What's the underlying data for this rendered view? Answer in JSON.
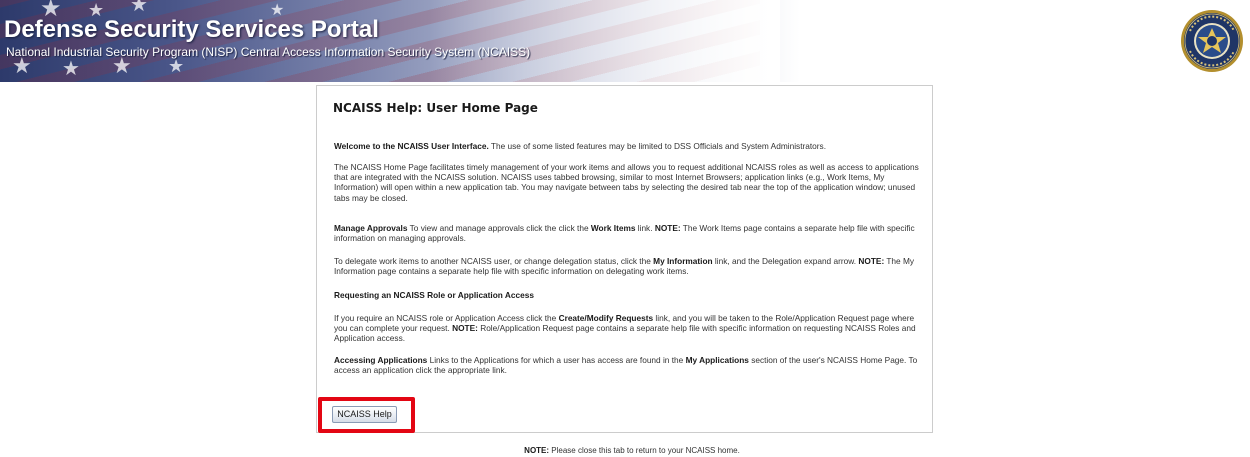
{
  "banner": {
    "title": "Defense Security Services Portal",
    "subtitle": "National Industrial Security Program (NISP) Central Access Information Security System (NCAISS)",
    "seal_icon": "dss-seal-icon"
  },
  "help": {
    "title": "NCAISS Help: User Home Page",
    "welcome": {
      "bold": "Welcome to the NCAISS User Interface.",
      "text": " The use of some listed features may be limited to DSS Officials and System Administrators."
    },
    "intro": "The NCAISS Home Page facilitates timely management of your work items and allows you to request additional NCAISS roles as well as access to applications that are integrated with the NCAISS solution. NCAISS uses tabbed browsing, similar to most Internet Browsers; application links (e.g., Work Items, My Information) will open within a new application tab. You may navigate between tabs by selecting the desired tab near the top of the application window; unused tabs may be closed.",
    "approvals": {
      "bold": "Manage Approvals",
      "text1": " To view and manage approvals click the click the ",
      "link": "Work Items",
      "text2": " link. ",
      "note_label": "NOTE:",
      "text3": " The Work Items page contains a separate help file with specific information on managing approvals."
    },
    "delegate": {
      "text1": "To delegate work items to another NCAISS user, or change delegation status, click the ",
      "link": "My Information",
      "text2": " link, and the Delegation expand arrow. ",
      "note_label": "NOTE:",
      "text3": " The My Information page contains a separate help file with specific information on delegating work items."
    },
    "requesting_heading": "Requesting an NCAISS Role or Application Access",
    "requesting": {
      "text1": "If you require an NCAISS role or Application Access click the ",
      "link": "Create/Modify Requests",
      "text2": " link, and you will be taken to the Role/Application Request page where you can complete your request. ",
      "note_label": "NOTE:",
      "text3": " Role/Application Request page contains a separate help file with specific information on requesting NCAISS Roles and Application access."
    },
    "accessing": {
      "bold": "Accessing Applications",
      "text1": " Links to the Applications for which a user has access are found in the ",
      "link": "My Applications",
      "text2": " section of the user's NCAISS Home Page. To access an application click the appropriate link."
    },
    "button_label": "NCAISS Help"
  },
  "footer": {
    "note_label": "NOTE:",
    "note_text": " Please close this tab to return to your NCAISS home."
  },
  "colors": {
    "highlight": "#e30613",
    "banner_dark": "#2d3a6b"
  }
}
